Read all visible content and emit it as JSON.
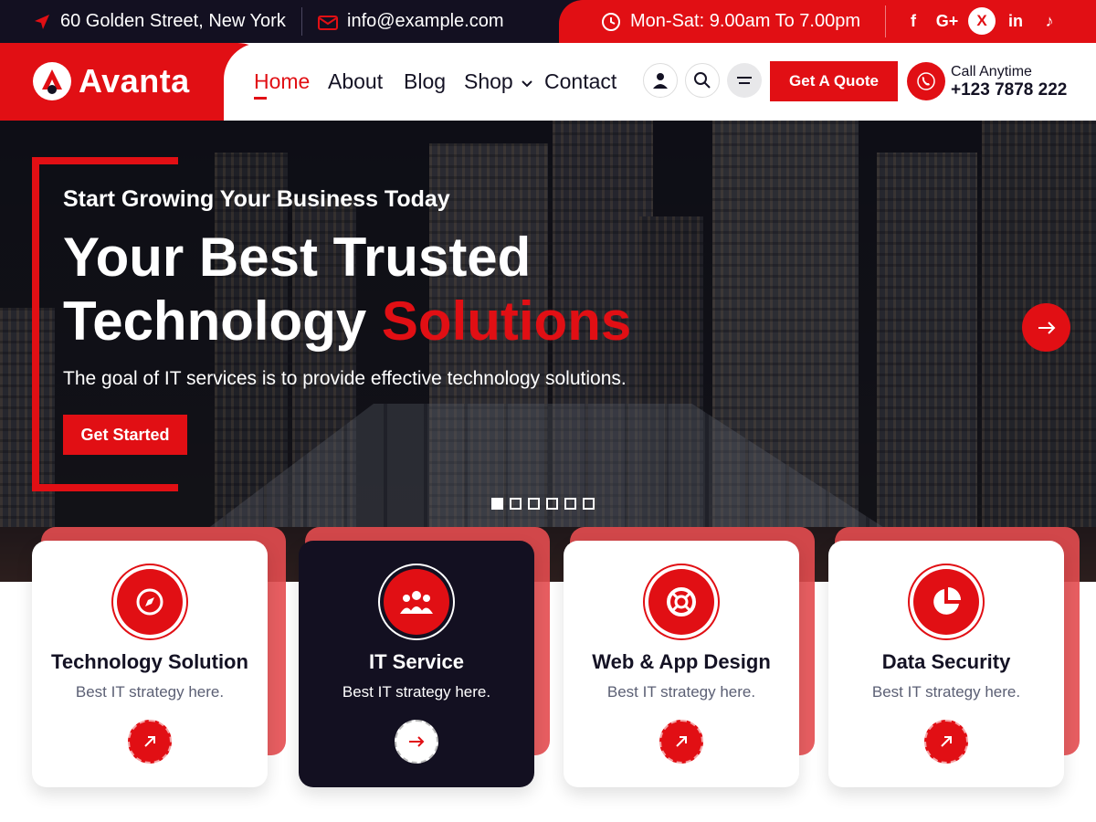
{
  "topbar": {
    "address": "60 Golden Street, New York",
    "email": "info@example.com",
    "hours": "Mon-Sat: 9.00am To 7.00pm",
    "social": [
      "f",
      "G+",
      "X",
      "in",
      "♪"
    ],
    "social_names": [
      "facebook-icon",
      "google-plus-icon",
      "x-icon",
      "linkedin-icon",
      "tiktok-icon"
    ]
  },
  "header": {
    "logo_text": "Avanta",
    "nav": [
      "Home",
      "About",
      "Blog",
      "Shop",
      "Contact"
    ],
    "active_nav": "Home",
    "quote_button": "Get A Quote",
    "call_label": "Call Anytime",
    "call_number": "+123 7878 222"
  },
  "hero": {
    "subtitle": "Start Growing Your Business Today",
    "title_line1": "Your Best Trusted",
    "title_line2_white": "Technology",
    "title_line2_red": "Solutions",
    "description": "The goal of IT services is to provide effective technology solutions.",
    "button": "Get Started",
    "slide_count": 6,
    "active_slide": 1
  },
  "cards": [
    {
      "title": "Technology Solution",
      "text": "Best IT strategy here.",
      "icon": "compass-icon",
      "dark": false
    },
    {
      "title": "IT Service",
      "text": "Best IT strategy here.",
      "icon": "users-icon",
      "dark": true
    },
    {
      "title": "Web & App Design",
      "text": "Best IT strategy here.",
      "icon": "lifebuoy-icon",
      "dark": false
    },
    {
      "title": "Data Security",
      "text": "Best IT strategy here.",
      "icon": "pie-chart-icon",
      "dark": false
    }
  ],
  "colors": {
    "accent": "#e10f14",
    "dark": "#131021",
    "text": "#141224"
  }
}
